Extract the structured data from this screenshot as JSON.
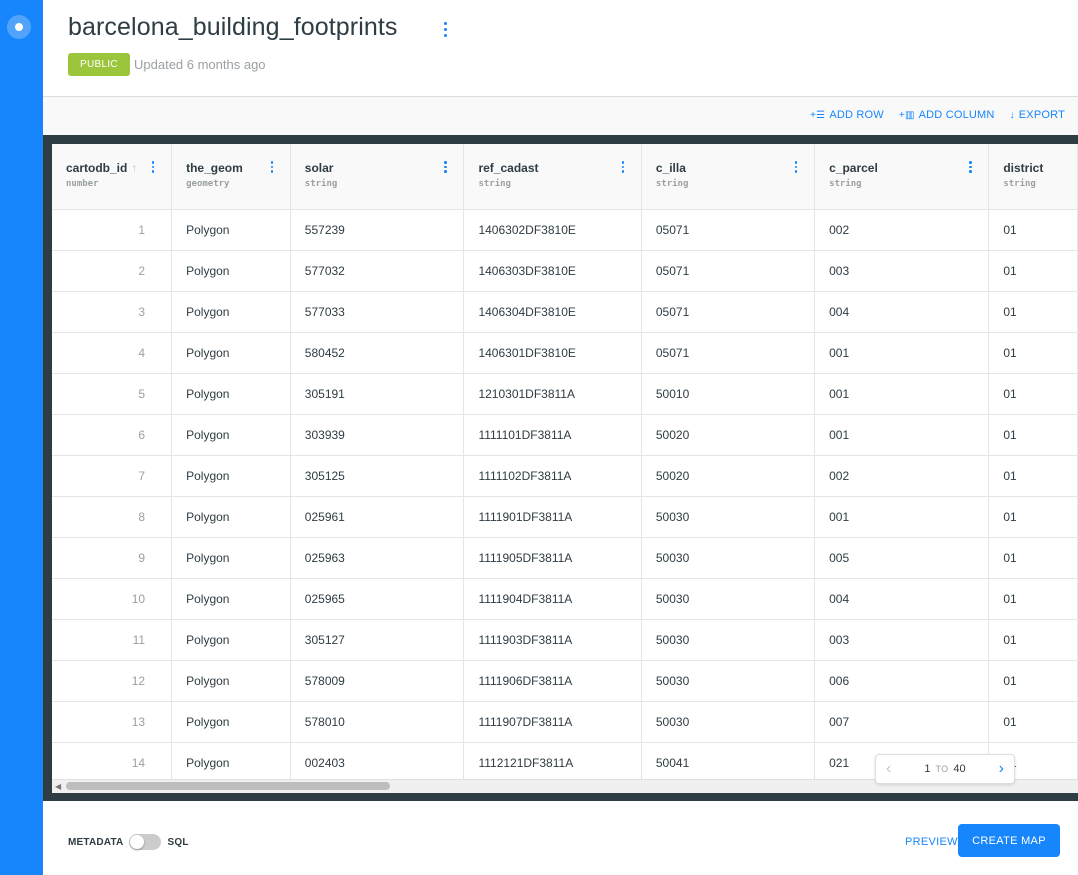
{
  "dataset": {
    "title": "barcelona_building_footprints",
    "visibility": "PUBLIC",
    "updated": "Updated 6 months ago"
  },
  "toolbar": {
    "add_row": "ADD ROW",
    "add_column": "ADD COLUMN",
    "export": "EXPORT"
  },
  "table": {
    "columns": [
      {
        "name": "cartodb_id",
        "type": "number"
      },
      {
        "name": "the_geom",
        "type": "geometry"
      },
      {
        "name": "solar",
        "type": "string"
      },
      {
        "name": "ref_cadast",
        "type": "string"
      },
      {
        "name": "c_illa",
        "type": "string"
      },
      {
        "name": "c_parcel",
        "type": "string"
      },
      {
        "name": "district",
        "type": "string"
      }
    ],
    "rows": [
      [
        "1",
        "Polygon",
        "557239",
        "1406302DF3810E",
        "05071",
        "002",
        "01"
      ],
      [
        "2",
        "Polygon",
        "577032",
        "1406303DF3810E",
        "05071",
        "003",
        "01"
      ],
      [
        "3",
        "Polygon",
        "577033",
        "1406304DF3810E",
        "05071",
        "004",
        "01"
      ],
      [
        "4",
        "Polygon",
        "580452",
        "1406301DF3810E",
        "05071",
        "001",
        "01"
      ],
      [
        "5",
        "Polygon",
        "305191",
        "1210301DF3811A",
        "50010",
        "001",
        "01"
      ],
      [
        "6",
        "Polygon",
        "303939",
        "1111101DF3811A",
        "50020",
        "001",
        "01"
      ],
      [
        "7",
        "Polygon",
        "305125",
        "1111102DF3811A",
        "50020",
        "002",
        "01"
      ],
      [
        "8",
        "Polygon",
        "025961",
        "1111901DF3811A",
        "50030",
        "001",
        "01"
      ],
      [
        "9",
        "Polygon",
        "025963",
        "1111905DF3811A",
        "50030",
        "005",
        "01"
      ],
      [
        "10",
        "Polygon",
        "025965",
        "1111904DF3811A",
        "50030",
        "004",
        "01"
      ],
      [
        "11",
        "Polygon",
        "305127",
        "1111903DF3811A",
        "50030",
        "003",
        "01"
      ],
      [
        "12",
        "Polygon",
        "578009",
        "1111906DF3811A",
        "50030",
        "006",
        "01"
      ],
      [
        "13",
        "Polygon",
        "578010",
        "1111907DF3811A",
        "50030",
        "007",
        "01"
      ],
      [
        "14",
        "Polygon",
        "002403",
        "1112121DF3811A",
        "50041",
        "021",
        "01"
      ]
    ]
  },
  "pagination": {
    "from": "1",
    "to_label": "TO",
    "to": "40"
  },
  "footer": {
    "metadata_label": "METADATA",
    "sql_label": "SQL",
    "preview": "PREVIEW",
    "create_map": "CREATE MAP"
  },
  "colors": {
    "accent": "#1785fb",
    "public_badge": "#9bc63b",
    "table_frame": "#2e3c43"
  },
  "icons": {
    "title_menu": "more-vertical-icon",
    "sort": "arrow-up-icon",
    "pager_prev": "chevron-left-icon",
    "pager_next": "chevron-right-icon"
  }
}
